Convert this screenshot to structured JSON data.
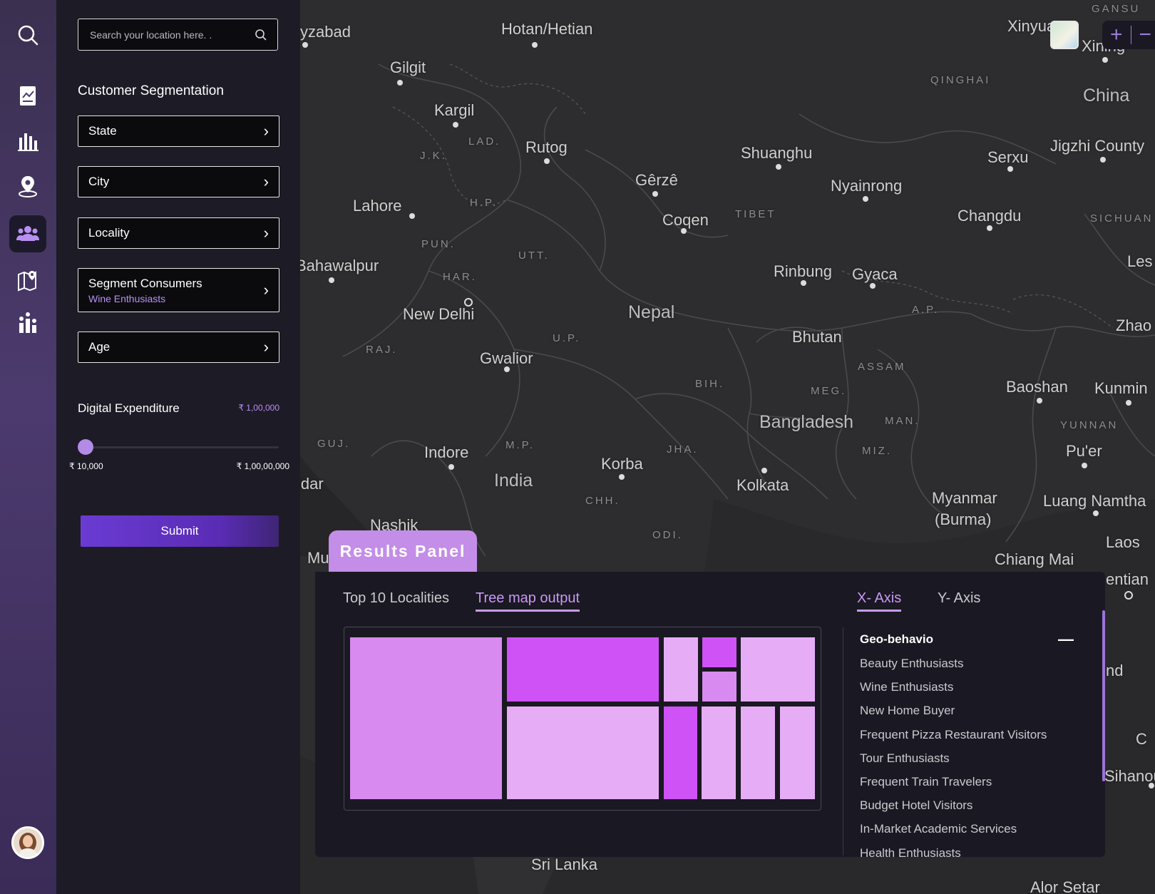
{
  "search": {
    "placeholder": "Search your location here. ."
  },
  "segmentation": {
    "title": "Customer Segmentation",
    "dropdowns": [
      {
        "label": "State"
      },
      {
        "label": "City"
      },
      {
        "label": "Locality"
      },
      {
        "label": "Segment Consumers",
        "selected": "Wine Enthusiasts"
      },
      {
        "label": "Age"
      }
    ]
  },
  "expenditure": {
    "label": "Digital Expenditure",
    "value": "₹ 1,00,000",
    "min_label": "₹ 10,000",
    "max_label": "₹ 1,00,00,000",
    "slider_fraction": 0.01
  },
  "submit_label": "Submit",
  "rail_icons": [
    "search-icon",
    "report-icon",
    "bar-chart-icon",
    "location-pin-icon",
    "users-icon",
    "map-pin-icon",
    "ranking-icon"
  ],
  "map": {
    "labels": {
      "hotan": "Hotan/Hetian",
      "gilgit": "Gilgit",
      "kargil": "Kargil",
      "lad": "LAD.",
      "jk": "J.K.",
      "rutog": "Rutog",
      "qinghai": "QINGHAI",
      "china": "China",
      "xinyua": "Xinyua",
      "xining": "Xining",
      "gansu": "GANSU",
      "yzabad": "yzabad",
      "shuanghu": "Shuanghu",
      "serxu": "Serxu",
      "jigzhi": "Jigzhi County",
      "gerze": "Gêrzê",
      "nyainrong": "Nyainrong",
      "lahore": "Lahore",
      "hp": "H.P.",
      "coqen": "Coqen",
      "tibet": "TIBET",
      "changdu": "Changdu",
      "sichuan": "SICHUAN",
      "pun": "PUN.",
      "utt": "UTT.",
      "bahawalpur": "Bahawalpur",
      "har": "HAR.",
      "les": "Les",
      "rinbung": "Rinbung",
      "gyaca": "Gyaca",
      "newdelhi": "New Delhi",
      "nepal": "Nepal",
      "ap": "A.P.",
      "zhao": "Zhao",
      "bhutan": "Bhutan",
      "raj": "RAJ.",
      "up": "U.P.",
      "gwalior": "Gwalior",
      "assam": "ASSAM",
      "bih": "BIH.",
      "meg": "MEG.",
      "baoshan": "Baoshan",
      "kunming": "Kunmin",
      "bangladesh": "Bangladesh",
      "man": "MAN.",
      "yunnan": "YUNNAN",
      "guj": "GUJ.",
      "indore": "Indore",
      "mp": "M.P.",
      "jha": "JHA.",
      "miz": "MIZ.",
      "puer": "Pu'er",
      "korba": "Korba",
      "kolkata": "Kolkata",
      "idar": "idar",
      "india": "India",
      "myanmar": "Myanmar",
      "burma": "(Burma)",
      "luang": "Luang Namtha",
      "chh": "CHH.",
      "nashik": "Nashik",
      "odi": "ODI.",
      "laos": "Laos",
      "mu": "Mu",
      "chiangmai": "Chiang Mai",
      "entian": "entian",
      "nd": "nd",
      "c": "C",
      "sihanou": "Sihanou",
      "srilanka": "Sri Lanka",
      "alorsetar": "Alor Setar"
    }
  },
  "results": {
    "tab_label": "Results Panel",
    "tabs": [
      "Top 10 Localities",
      "Tree map output"
    ],
    "axis_tabs": [
      "X- Axis",
      "Y- Axis"
    ],
    "list_title": "Geo-behavio",
    "list_items": [
      "Beauty Enthusiasts",
      "Wine Enthusiasts",
      "New Home Buyer",
      "Frequent Pizza Restaurant Visitors",
      "Tour Enthusiasts",
      "Frequent Train Travelers",
      "Budget Hotel Visitors",
      "In-Market Academic Services",
      "Health Enthusiasts"
    ],
    "colors": {
      "light": "#e6adf6",
      "mid": "#d88af0",
      "strong": "#cf52f7",
      "accent": "#c79af3"
    }
  }
}
